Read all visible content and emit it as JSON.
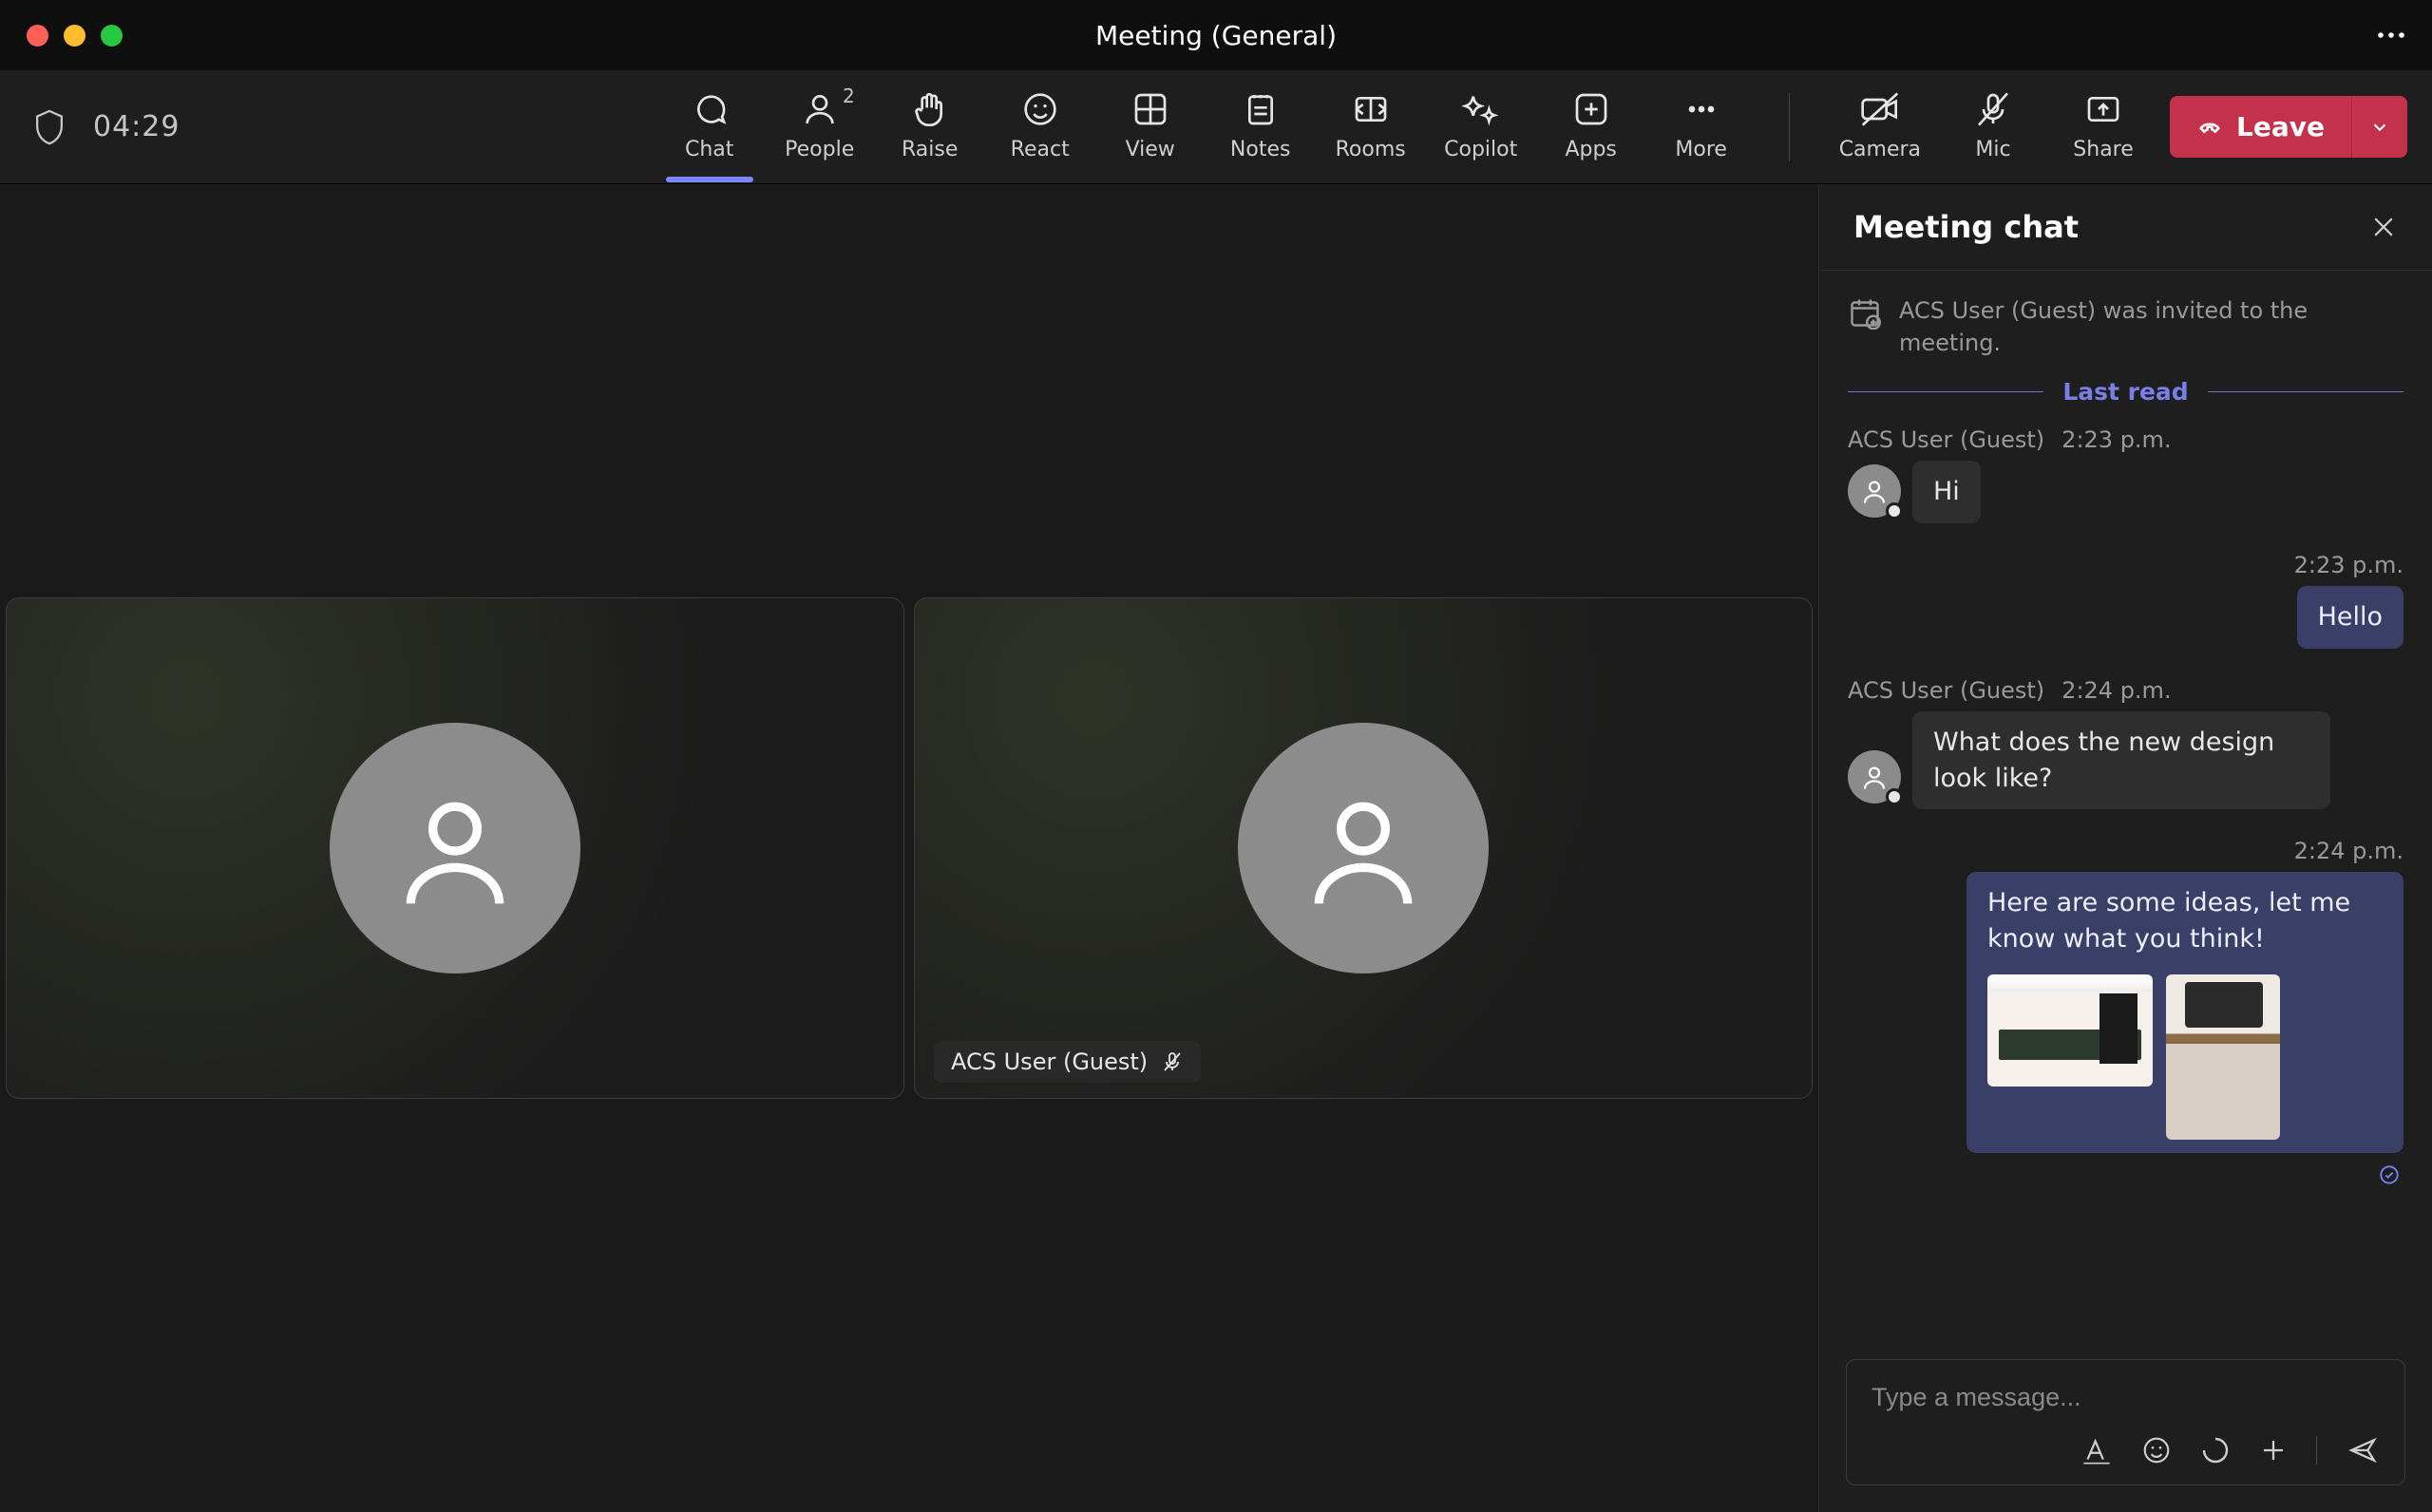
{
  "window": {
    "title": "Meeting (General)"
  },
  "timer": "04:29",
  "toolbar": {
    "chat": "Chat",
    "people": "People",
    "people_count": "2",
    "raise": "Raise",
    "react": "React",
    "view": "View",
    "notes": "Notes",
    "rooms": "Rooms",
    "copilot": "Copilot",
    "apps": "Apps",
    "more": "More",
    "camera": "Camera",
    "mic": "Mic",
    "share": "Share",
    "leave": "Leave"
  },
  "stage": {
    "participants": [
      {
        "name": ""
      },
      {
        "name": "ACS User (Guest)",
        "muted": true
      }
    ]
  },
  "chat": {
    "title": "Meeting chat",
    "system": "ACS User (Guest) was invited to the meeting.",
    "last_read": "Last read",
    "messages": [
      {
        "sender": "ACS User (Guest)",
        "time": "2:23 p.m.",
        "side": "in",
        "text": "Hi"
      },
      {
        "sender": "",
        "time": "2:23 p.m.",
        "side": "out",
        "text": "Hello"
      },
      {
        "sender": "ACS User (Guest)",
        "time": "2:24 p.m.",
        "side": "in",
        "text": "What does the new design look like?"
      },
      {
        "sender": "",
        "time": "2:24 p.m.",
        "side": "out",
        "text": "Here are some ideas, let me know what you think!",
        "attachments": 2
      }
    ],
    "compose_placeholder": "Type a message..."
  }
}
